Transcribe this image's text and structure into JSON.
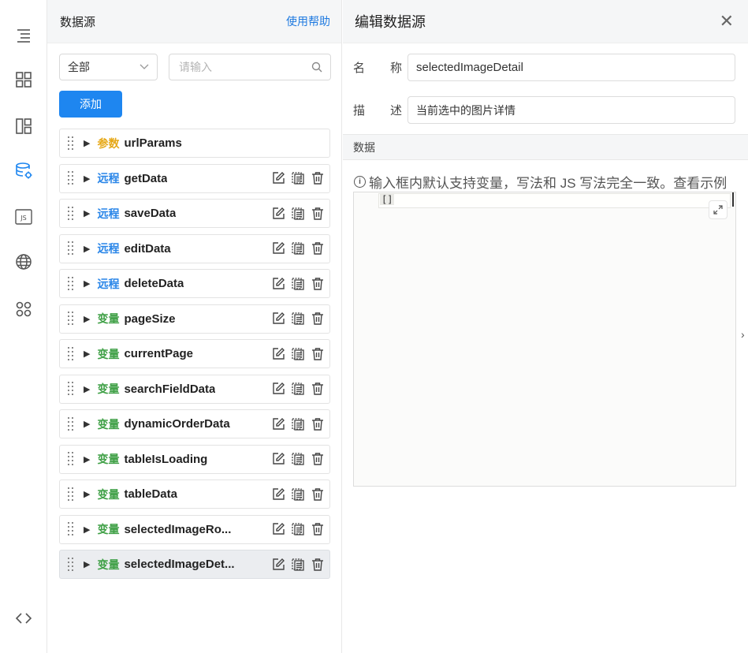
{
  "rail": {
    "icons": [
      "outline-icon",
      "components-icon",
      "layout-icon",
      "datasource-icon",
      "js-icon",
      "globe-icon",
      "apps-icon",
      "code-icon"
    ],
    "active_icon": "datasource-icon",
    "active_color": "#1e86f0",
    "js_label": "JS"
  },
  "panel": {
    "title": "数据源",
    "help_link": "使用帮助",
    "filter_value": "全部",
    "search_placeholder": "请输入",
    "add_button": "添加"
  },
  "datasources": [
    {
      "type": "参数",
      "kind": "param",
      "name": "urlParams",
      "has_actions": false
    },
    {
      "type": "远程",
      "kind": "remote",
      "name": "getData",
      "has_actions": true
    },
    {
      "type": "远程",
      "kind": "remote",
      "name": "saveData",
      "has_actions": true
    },
    {
      "type": "远程",
      "kind": "remote",
      "name": "editData",
      "has_actions": true
    },
    {
      "type": "远程",
      "kind": "remote",
      "name": "deleteData",
      "has_actions": true
    },
    {
      "type": "变量",
      "kind": "var",
      "name": "pageSize",
      "has_actions": true
    },
    {
      "type": "变量",
      "kind": "var",
      "name": "currentPage",
      "has_actions": true
    },
    {
      "type": "变量",
      "kind": "var",
      "name": "searchFieldData",
      "has_actions": true
    },
    {
      "type": "变量",
      "kind": "var",
      "name": "dynamicOrderData",
      "has_actions": true
    },
    {
      "type": "变量",
      "kind": "var",
      "name": "tableIsLoading",
      "has_actions": true
    },
    {
      "type": "变量",
      "kind": "var",
      "name": "tableData",
      "has_actions": true
    },
    {
      "type": "变量",
      "kind": "var",
      "name": "selectedImageRo...",
      "has_actions": true
    },
    {
      "type": "变量",
      "kind": "var",
      "name": "selectedImageDet...",
      "has_actions": true,
      "selected": true
    }
  ],
  "type_colors": {
    "param": "#e6a817",
    "remote": "#2a86e8",
    "var": "#3fa046"
  },
  "editor": {
    "title": "编辑数据源",
    "name_label_1": "名",
    "name_label_2": "称",
    "name_value": "selectedImageDetail",
    "desc_label_1": "描",
    "desc_label_2": "述",
    "desc_value": "当前选中的图片详情",
    "section_label": "数据",
    "hint_text": "输入框内默认支持变量，写法和 JS 写法完全一致。",
    "hint_link": "查看示例",
    "code": "[]"
  }
}
